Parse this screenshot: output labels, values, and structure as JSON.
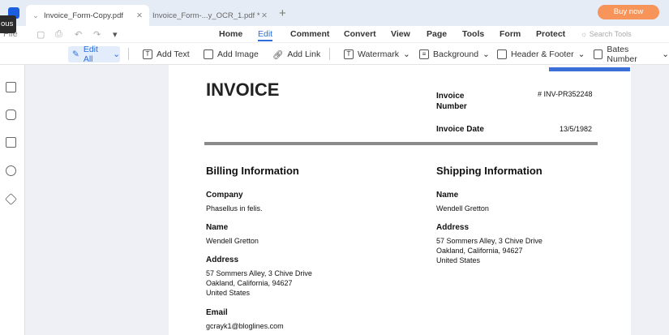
{
  "tooltip": "ous",
  "tabs": [
    {
      "label": "Invoice_Form-Copy.pdf"
    },
    {
      "label": "Invoice_Form-...y_OCR_1.pdf *"
    }
  ],
  "buy_now": "Buy now",
  "file_menu": "File",
  "menu": [
    "Home",
    "Edit",
    "Comment",
    "Convert",
    "View",
    "Page",
    "Tools",
    "Form",
    "Protect"
  ],
  "search_placeholder": "Search Tools",
  "toolbar": {
    "edit_all": "Edit All",
    "add_text": "Add Text",
    "add_image": "Add Image",
    "add_link": "Add Link",
    "watermark": "Watermark",
    "background": "Background",
    "header_footer": "Header & Footer",
    "bates": "Bates Number"
  },
  "invoice": {
    "title": "INVOICE",
    "number_label": "Invoice Number",
    "number": "# INV-PR352248",
    "date_label": "Invoice Date",
    "date": "13/5/1982",
    "billing": {
      "heading": "Billing Information",
      "company_label": "Company",
      "company": "Phasellus in felis.",
      "name_label": "Name",
      "name": "Wendell Gretton",
      "address_label": "Address",
      "address1": "57 Sommers Alley, 3 Chive Drive",
      "address2": "Oakland, California, 94627",
      "address3": "United States",
      "email_label": "Email",
      "email": "gcrayk1@bloglines.com"
    },
    "shipping": {
      "heading": "Shipping Information",
      "name_label": "Name",
      "name": "Wendell Gretton",
      "address_label": "Address",
      "address1": "57 Sommers Alley, 3 Chive Drive",
      "address2": "Oakland, California, 94627",
      "address3": "United States"
    }
  }
}
